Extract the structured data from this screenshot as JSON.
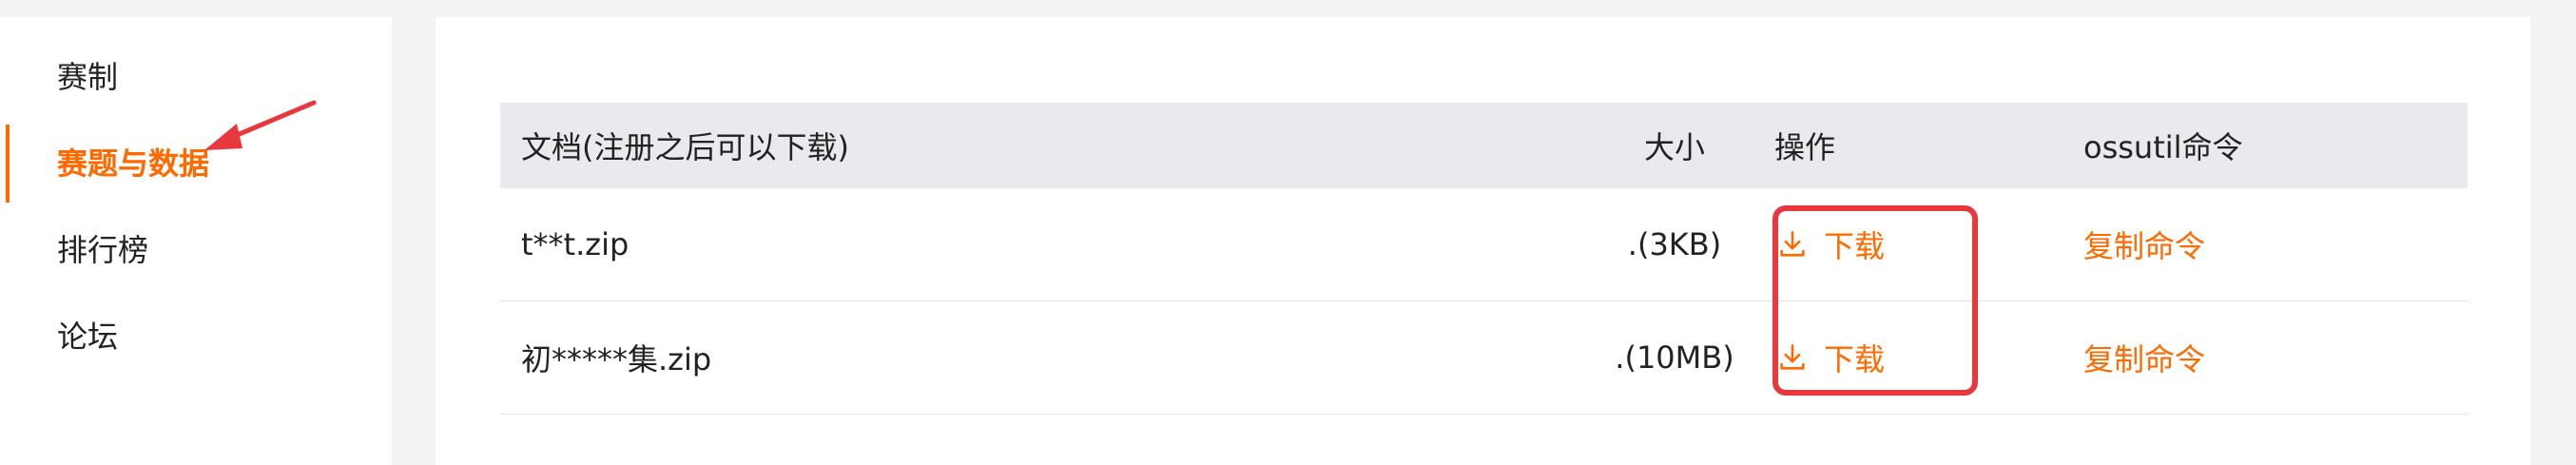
{
  "sidebar": {
    "items": [
      {
        "label": "赛制",
        "active": false
      },
      {
        "label": "赛题与数据",
        "active": true
      },
      {
        "label": "排行榜",
        "active": false
      },
      {
        "label": "论坛",
        "active": false
      }
    ]
  },
  "table": {
    "headers": {
      "name": "文档(注册之后可以下载)",
      "size": "大小",
      "operation": "操作",
      "command": "ossutil命令"
    },
    "rows": [
      {
        "name": "t**t.zip",
        "size": ".(3KB)",
        "download_label": "下载",
        "copy_label": "复制命令"
      },
      {
        "name": "初*****集.zip",
        "size": ".(10MB)",
        "download_label": "下载",
        "copy_label": "复制命令"
      }
    ]
  },
  "colors": {
    "accent": "#ff6a00",
    "annotation": "#e8383d",
    "header_bg": "#e9eaee"
  },
  "icons": {
    "download": "download-icon",
    "annotation_arrow": "arrow-icon"
  }
}
